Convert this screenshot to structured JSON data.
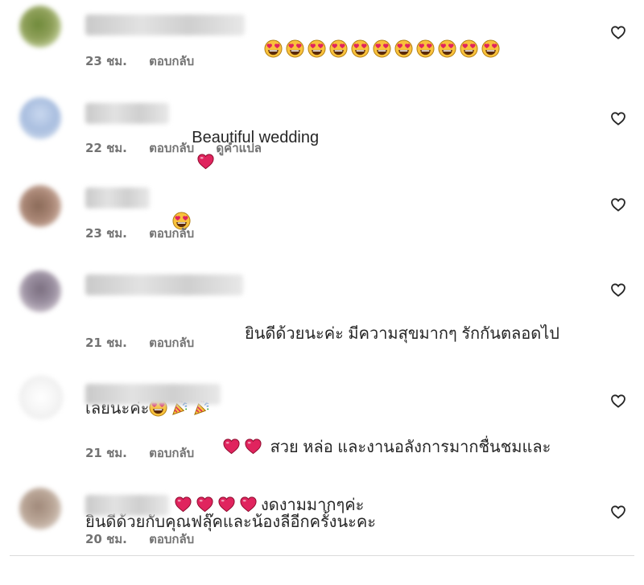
{
  "comments": [
    {
      "text": "",
      "emojis": [
        "smiling-heart-eyes-emoji",
        "smiling-heart-eyes-emoji",
        "smiling-heart-eyes-emoji",
        "smiling-heart-eyes-emoji",
        "smiling-heart-eyes-emoji",
        "smiling-heart-eyes-emoji",
        "smiling-heart-eyes-emoji",
        "smiling-heart-eyes-emoji",
        "smiling-heart-eyes-emoji",
        "smiling-heart-eyes-emoji",
        "smiling-heart-eyes-emoji"
      ],
      "time": "23 ชม.",
      "reply": "ตอบกลับ",
      "translate": ""
    },
    {
      "text": "Beautiful wedding",
      "time": "22 ชม.",
      "reply": "ตอบกลับ",
      "translate": "ดูคำแปล"
    },
    {
      "text": "",
      "time": "23 ชม.",
      "reply": "ตอบกลับ",
      "translate": ""
    },
    {
      "text_line1": "ยินดีด้วยนะค่ะ มีความสุขมากๆ รักกันตลอดไป",
      "text_line2": "เลยนะค่ะ",
      "time": "21 ชม.",
      "reply": "ตอบกลับ",
      "translate": ""
    },
    {
      "text_line1": "สวย หล่อ และงานอลังการมากชื่นชมและ",
      "text_line2": "ยินดีด้วยกับคุณฟลุ๊คและน้องลีอีกครั้งนะคะ",
      "time": "21 ชม.",
      "reply": "ตอบกลับ",
      "translate": ""
    },
    {
      "text": "งดงามมากๆค่ะ",
      "time": "20 ชม.",
      "reply": "ตอบกลับ",
      "translate": ""
    }
  ],
  "icons": {
    "like": "heart-outline-icon",
    "heart": "red-heart-emoji",
    "heart_eyes": "smiling-heart-eyes-emoji",
    "popper": "party-popper-emoji"
  },
  "colors": {
    "text": "#262626",
    "meta": "#737373",
    "heart": "#e0245e",
    "emoji_face": "#f9c23c"
  }
}
